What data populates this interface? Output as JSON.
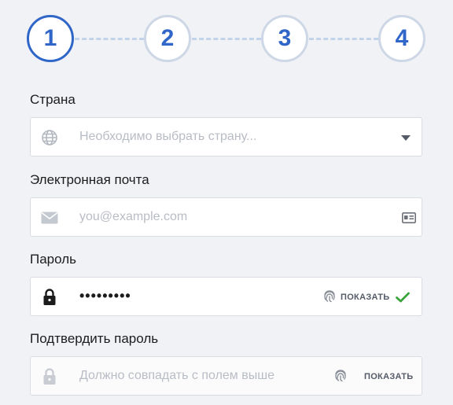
{
  "stepper": {
    "steps": [
      "1",
      "2",
      "3",
      "4"
    ],
    "active_index": 0
  },
  "form": {
    "country": {
      "label": "Страна",
      "placeholder": "Необходимо выбрать страну...",
      "lead_icon": "globe-icon",
      "trail_icon": "caret-down-icon"
    },
    "email": {
      "label": "Электронная почта",
      "placeholder": "you@example.com",
      "lead_icon": "envelope-icon",
      "trail_icon": "id-card-icon"
    },
    "password": {
      "label": "Пароль",
      "value": "•••••••••",
      "lead_icon": "lock-icon",
      "show_label": "ПОКАЗАТЬ",
      "show_icon": "fingerprint-icon",
      "status_icon": "checkmark-icon"
    },
    "confirm_password": {
      "label": "Подтвердить пароль",
      "placeholder": "Должно совпадать с полем выше",
      "lead_icon": "lock-icon",
      "show_label": "ПОКАЗАТЬ",
      "show_icon": "fingerprint-icon"
    }
  },
  "colors": {
    "accent": "#2f66c8",
    "step_border_inactive": "#cdd7e6",
    "dashed_line": "#c3d3ea",
    "valid": "#3aa53a",
    "background": "#f1f2f6",
    "placeholder": "#b8bcc4"
  }
}
